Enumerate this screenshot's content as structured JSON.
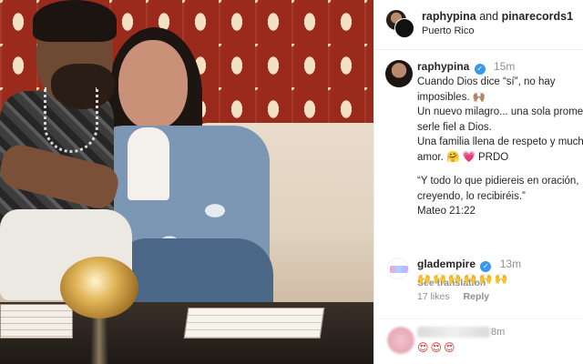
{
  "post": {
    "header": {
      "user": "raphypina",
      "connector": "and",
      "collaborator": "pinarecords1",
      "location": "Puerto Rico"
    },
    "caption": {
      "user": "raphypina",
      "time": "15m",
      "lines": [
        "Cuando Dios dice “sí”, no hay",
        "imposibles. 🙌🏽",
        "Un nuevo milagro... una sola promesa,",
        "serle fiel a Dios.",
        "Una familia llena de respeto y mucho",
        "amor. 🤗 💗 PRDO",
        "",
        "“Y todo lo que pidiereis en oración,",
        "creyendo, lo recibiréis.”",
        "Mateo 21:22"
      ],
      "see_translation": "See translation"
    },
    "comments": [
      {
        "user": "gladempire",
        "time": "13m",
        "body": "🙌🙌🙌🙌🙌🙌",
        "likes": "17 likes",
        "reply": "Reply"
      },
      {
        "time": "8m",
        "body": "😍😍😍"
      }
    ]
  },
  "colors": {
    "verified": "#3897f0",
    "muted_text": "#8e8e8e",
    "text": "#262626"
  },
  "icons": {
    "verified": "verified-badge-icon"
  }
}
